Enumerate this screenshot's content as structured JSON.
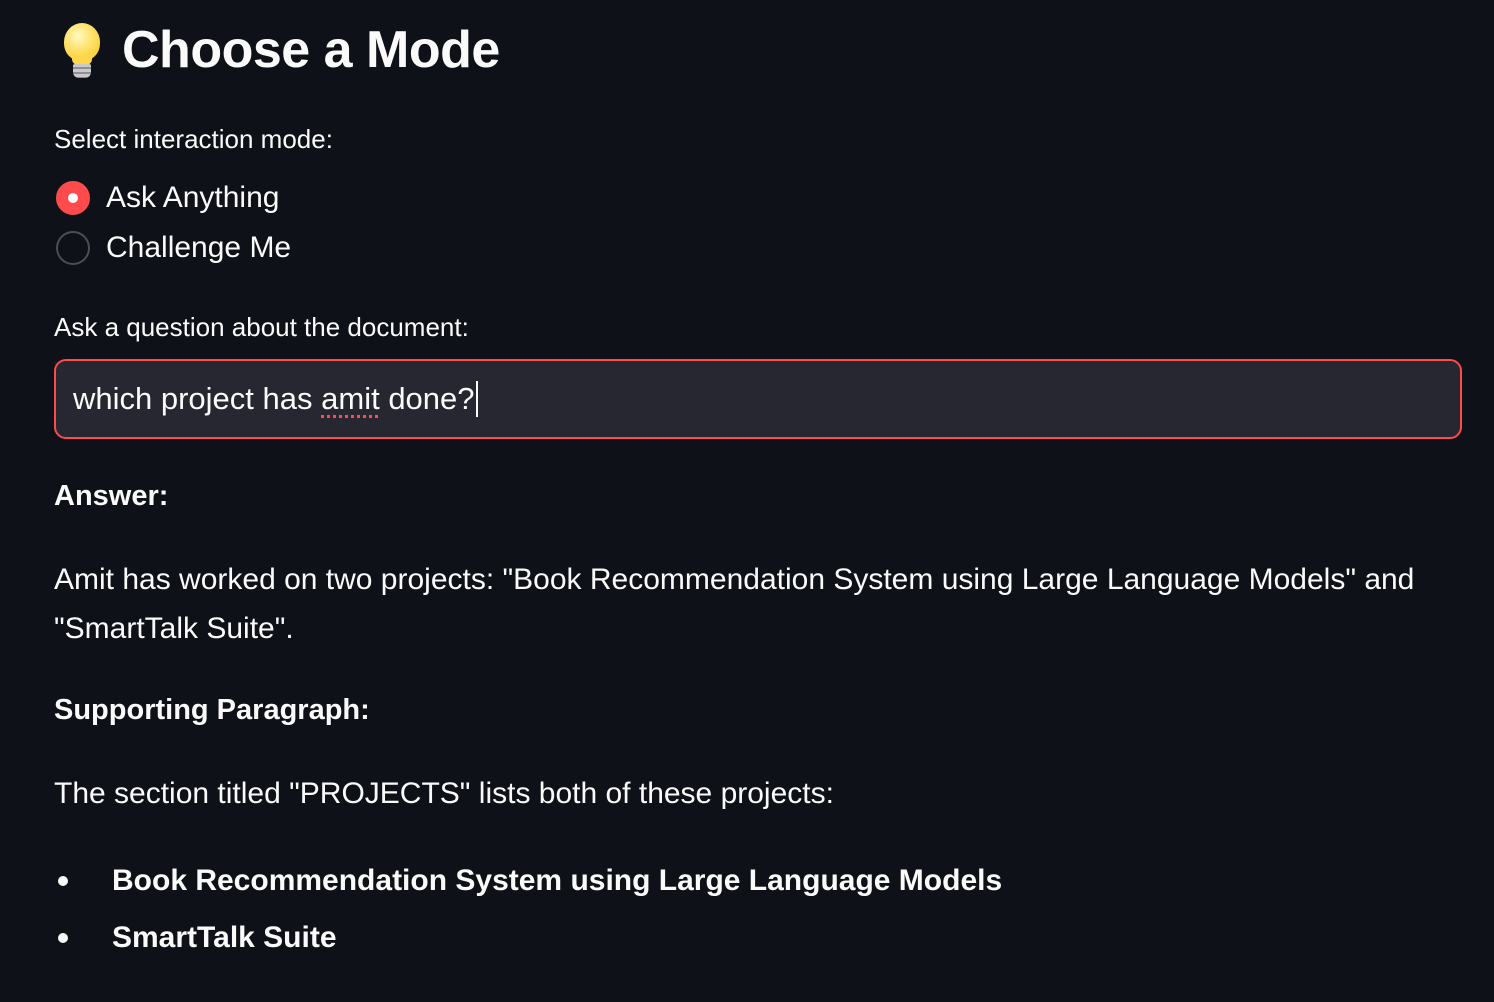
{
  "header": {
    "icon": "lightbulb-icon",
    "title": "Choose a Mode"
  },
  "mode_selector": {
    "label": "Select interaction mode:",
    "options": [
      {
        "label": "Ask Anything",
        "selected": true
      },
      {
        "label": "Challenge Me",
        "selected": false
      }
    ]
  },
  "question": {
    "label": "Ask a question about the document:",
    "value_before": "which project has ",
    "value_flagged": "amit",
    "value_after": " done?"
  },
  "answer": {
    "heading": "Answer:",
    "text": "Amit has worked on two projects: \"Book Recommendation System using Large Language Models\" and \"SmartTalk Suite\"."
  },
  "supporting": {
    "heading": "Supporting Paragraph:",
    "text": "The section titled \"PROJECTS\" lists both of these projects:",
    "items": [
      "Book Recommendation System using Large Language Models",
      "SmartTalk Suite"
    ]
  },
  "colors": {
    "background": "#0e1117",
    "accent": "#ff4b4b",
    "input_background": "#262730",
    "text": "#fafafa"
  }
}
